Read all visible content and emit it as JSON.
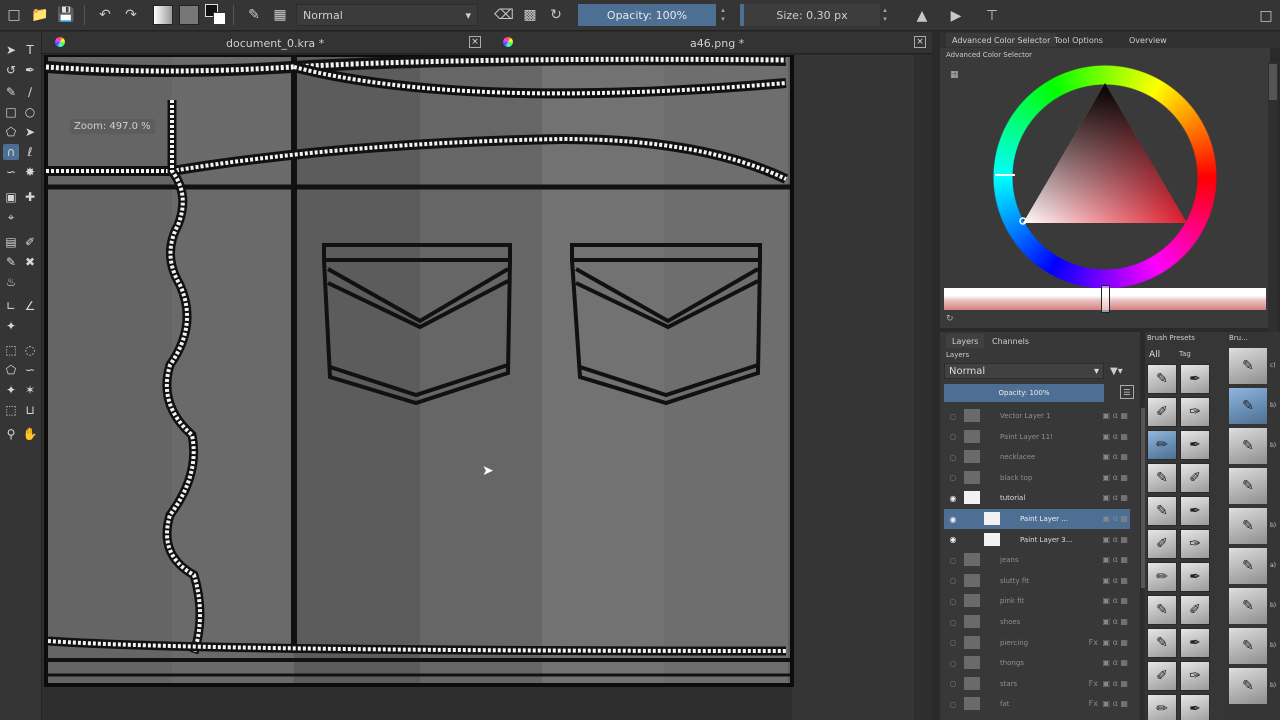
{
  "toolbar": {
    "blend_mode": "Normal",
    "opacity": "Opacity: 100%",
    "size": "Size: 0.30 px"
  },
  "tabs": [
    {
      "title": "document_0.kra *"
    },
    {
      "title": "a46.png *"
    }
  ],
  "canvas": {
    "zoom": "Zoom: 497.0 %"
  },
  "right_tabs": [
    "Advanced Color Selector",
    "Tool Options",
    "Overview"
  ],
  "color_panel": {
    "title": "Advanced Color Selector",
    "selected_color": "#e01a2a"
  },
  "layers_panel": {
    "tabs": [
      "Layers",
      "Channels"
    ],
    "caption": "Layers",
    "blend_mode": "Normal",
    "opacity": "Opacity: 100%",
    "rows": [
      {
        "name": "Vector Layer 1",
        "visible": false,
        "selected": false,
        "thumb": "gray",
        "fx": false
      },
      {
        "name": "Paint Layer 11!",
        "visible": false,
        "selected": false,
        "thumb": "gray",
        "fx": false
      },
      {
        "name": "necklacee",
        "visible": false,
        "selected": false,
        "thumb": "gray",
        "fx": false
      },
      {
        "name": "black top",
        "visible": false,
        "selected": false,
        "thumb": "gray",
        "fx": false
      },
      {
        "name": "tutorial",
        "visible": true,
        "selected": false,
        "thumb": "white",
        "fx": false
      },
      {
        "name": "Paint Layer ...",
        "visible": true,
        "selected": true,
        "thumb": "white",
        "fx": false
      },
      {
        "name": "Paint Layer 3...",
        "visible": true,
        "selected": false,
        "thumb": "white",
        "fx": false
      },
      {
        "name": "jeans",
        "visible": false,
        "selected": false,
        "thumb": "gray",
        "fx": false
      },
      {
        "name": "slutty fit",
        "visible": false,
        "selected": false,
        "thumb": "gray",
        "fx": false
      },
      {
        "name": "pink fit",
        "visible": false,
        "selected": false,
        "thumb": "gray",
        "fx": false
      },
      {
        "name": "shoes",
        "visible": false,
        "selected": false,
        "thumb": "gray",
        "fx": false
      },
      {
        "name": "piercing",
        "visible": false,
        "selected": false,
        "thumb": "gray",
        "fx": true
      },
      {
        "name": "thongs",
        "visible": false,
        "selected": false,
        "thumb": "gray",
        "fx": false
      },
      {
        "name": "stars",
        "visible": false,
        "selected": false,
        "thumb": "gray",
        "fx": true
      },
      {
        "name": "fat",
        "visible": false,
        "selected": false,
        "thumb": "gray",
        "fx": true
      }
    ]
  },
  "brush_presets": {
    "title": "Brush Presets",
    "filter": "All",
    "tag": "Tag",
    "title2": "Bru...",
    "strip_labels": [
      "c)",
      "b)",
      "b)",
      "",
      "b)",
      "a)",
      "b)",
      "b)",
      "b)"
    ]
  },
  "colors": {
    "accent": "#4c6f93",
    "panel": "#383838",
    "canvas_bg": "#303030"
  }
}
